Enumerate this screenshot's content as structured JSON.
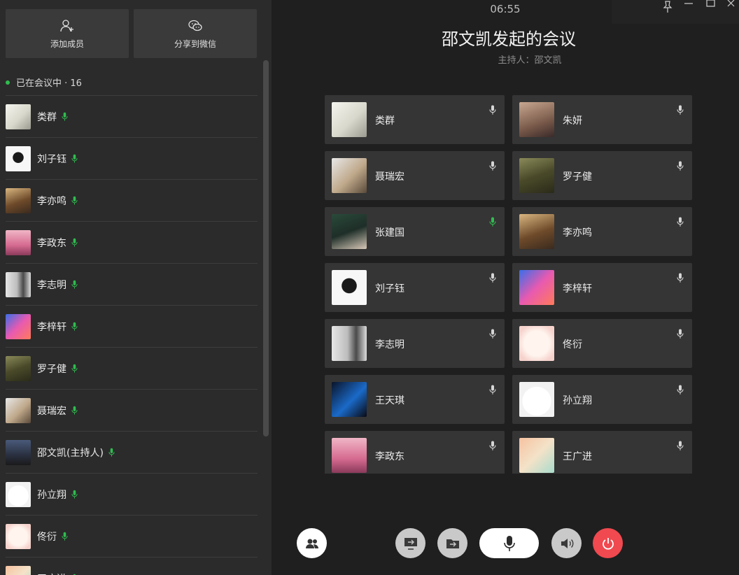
{
  "sidebar": {
    "add_member_label": "添加成员",
    "share_wechat_label": "分享到微信",
    "members_header": "已在会议中 · 16",
    "members": [
      {
        "name": "类群",
        "mic": "active",
        "avatar": "sketch-portrait"
      },
      {
        "name": "刘子钰",
        "mic": "active",
        "avatar": "meme"
      },
      {
        "name": "李亦鸣",
        "mic": "active",
        "avatar": "painting"
      },
      {
        "name": "李政东",
        "mic": "active",
        "avatar": "pink-tower"
      },
      {
        "name": "李志明",
        "mic": "active",
        "avatar": "silhouette"
      },
      {
        "name": "李梓轩",
        "mic": "active",
        "avatar": "anime-glasses"
      },
      {
        "name": "罗子健",
        "mic": "active",
        "avatar": "warrior"
      },
      {
        "name": "聂瑞宏",
        "mic": "active",
        "avatar": "toy-figure"
      },
      {
        "name": "邵文凯(主持人)",
        "mic": "active",
        "avatar": "night-person"
      },
      {
        "name": "孙立翔",
        "mic": "active",
        "avatar": "white-blob"
      },
      {
        "name": "佟衍",
        "mic": "active",
        "avatar": "cute-face"
      },
      {
        "name": "王广进",
        "mic": "active",
        "avatar": "cat-cartoon"
      }
    ]
  },
  "header": {
    "time": "06:55",
    "title": "邵文凯发起的会议",
    "host": "主持人：邵文凯"
  },
  "participants": [
    {
      "name": "类群",
      "mic": "muted",
      "avatar": "sketch-portrait"
    },
    {
      "name": "朱妍",
      "mic": "muted",
      "avatar": "child-photo"
    },
    {
      "name": "聂瑞宏",
      "mic": "muted",
      "avatar": "toy-figure"
    },
    {
      "name": "罗子健",
      "mic": "muted",
      "avatar": "warrior"
    },
    {
      "name": "张建国",
      "mic": "active",
      "avatar": "anime-boy"
    },
    {
      "name": "李亦鸣",
      "mic": "muted",
      "avatar": "painting"
    },
    {
      "name": "刘子钰",
      "mic": "muted",
      "avatar": "meme"
    },
    {
      "name": "李梓轩",
      "mic": "muted",
      "avatar": "anime-glasses"
    },
    {
      "name": "李志明",
      "mic": "muted",
      "avatar": "silhouette"
    },
    {
      "name": "佟衍",
      "mic": "muted",
      "avatar": "cute-face"
    },
    {
      "name": "王天琪",
      "mic": "muted",
      "avatar": "blue-dark"
    },
    {
      "name": "孙立翔",
      "mic": "muted",
      "avatar": "white-blob"
    },
    {
      "name": "李政东",
      "mic": "muted",
      "avatar": "pink-tower"
    },
    {
      "name": "王广进",
      "mic": "muted",
      "avatar": "cat-cartoon"
    }
  ],
  "controls": {
    "members_icon": "members-icon",
    "share_screen_icon": "share-screen-icon",
    "share_file_icon": "share-file-icon",
    "mic_icon": "mic-icon",
    "speaker_icon": "speaker-icon",
    "leave_icon": "power-icon"
  },
  "colors": {
    "active_mic": "#2fbd4f",
    "leave": "#f0494f"
  }
}
